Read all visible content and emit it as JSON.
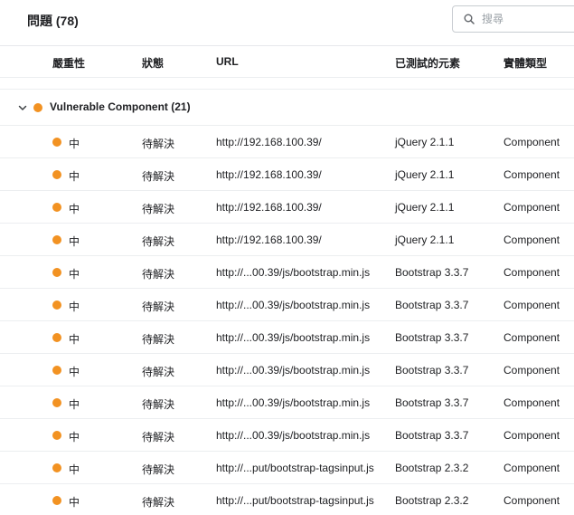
{
  "header": {
    "title": "問題 (78)",
    "search": {
      "placeholder": "搜尋",
      "value": ""
    }
  },
  "columns": [
    "嚴重性",
    "狀態",
    "URL",
    "已測試的元素",
    "實體類型"
  ],
  "group": {
    "label": "Vulnerable Component (21)",
    "color": "#f29222",
    "expanded": true
  },
  "rows": [
    {
      "severity": "中",
      "status": "待解決",
      "url": "http://192.168.100.39/",
      "element": "jQuery 2.1.1",
      "type": "Component"
    },
    {
      "severity": "中",
      "status": "待解決",
      "url": "http://192.168.100.39/",
      "element": "jQuery 2.1.1",
      "type": "Component"
    },
    {
      "severity": "中",
      "status": "待解決",
      "url": "http://192.168.100.39/",
      "element": "jQuery 2.1.1",
      "type": "Component"
    },
    {
      "severity": "中",
      "status": "待解決",
      "url": "http://192.168.100.39/",
      "element": "jQuery 2.1.1",
      "type": "Component"
    },
    {
      "severity": "中",
      "status": "待解決",
      "url": "http://...00.39/js/bootstrap.min.js",
      "element": "Bootstrap 3.3.7",
      "type": "Component"
    },
    {
      "severity": "中",
      "status": "待解決",
      "url": "http://...00.39/js/bootstrap.min.js",
      "element": "Bootstrap 3.3.7",
      "type": "Component"
    },
    {
      "severity": "中",
      "status": "待解決",
      "url": "http://...00.39/js/bootstrap.min.js",
      "element": "Bootstrap 3.3.7",
      "type": "Component"
    },
    {
      "severity": "中",
      "status": "待解決",
      "url": "http://...00.39/js/bootstrap.min.js",
      "element": "Bootstrap 3.3.7",
      "type": "Component"
    },
    {
      "severity": "中",
      "status": "待解決",
      "url": "http://...00.39/js/bootstrap.min.js",
      "element": "Bootstrap 3.3.7",
      "type": "Component"
    },
    {
      "severity": "中",
      "status": "待解決",
      "url": "http://...00.39/js/bootstrap.min.js",
      "element": "Bootstrap 3.3.7",
      "type": "Component"
    },
    {
      "severity": "中",
      "status": "待解決",
      "url": "http://...put/bootstrap-tagsinput.js",
      "element": "Bootstrap 2.3.2",
      "type": "Component"
    },
    {
      "severity": "中",
      "status": "待解決",
      "url": "http://...put/bootstrap-tagsinput.js",
      "element": "Bootstrap 2.3.2",
      "type": "Component"
    }
  ],
  "icons": {
    "search": "search-icon",
    "chevron": "chevron-down-icon",
    "severity_dot": "severity-dot-icon"
  },
  "colors": {
    "severity_medium": "#f29222"
  }
}
